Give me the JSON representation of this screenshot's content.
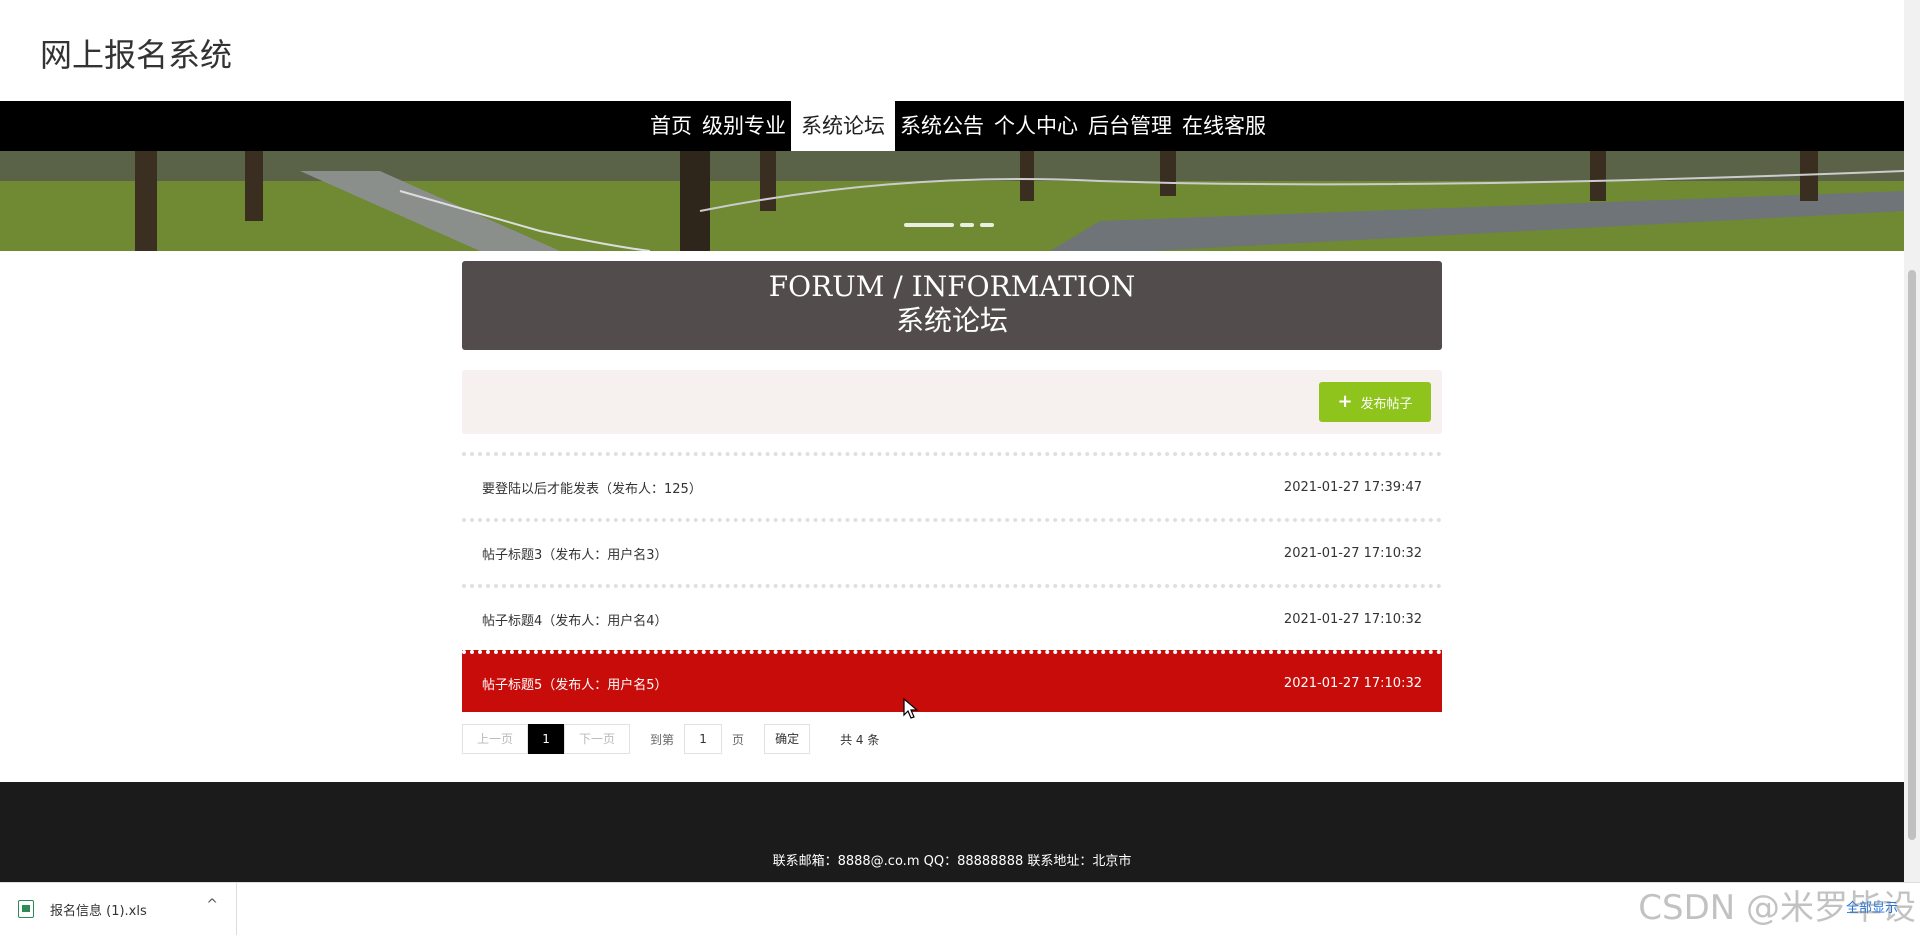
{
  "site": {
    "title": "网上报名系统"
  },
  "nav": {
    "items": [
      {
        "label": "首页",
        "active": false
      },
      {
        "label": "级别专业",
        "active": false
      },
      {
        "label": "系统论坛",
        "active": true
      },
      {
        "label": "系统公告",
        "active": false
      },
      {
        "label": "个人中心",
        "active": false
      },
      {
        "label": "后台管理",
        "active": false
      },
      {
        "label": "在线客服",
        "active": false
      }
    ]
  },
  "section": {
    "title_en": "FORUM / INFORMATION",
    "title_cn": "系统论坛"
  },
  "toolbar": {
    "publish_label": "发布帖子",
    "publish_icon": "plus-icon",
    "publish_color": "#8ec41c"
  },
  "posts": [
    {
      "title": "要登陆以后才能发表（发布人：125）",
      "time": "2021-01-27 17:39:47"
    },
    {
      "title": "帖子标题3（发布人：用户名3）",
      "time": "2021-01-27 17:10:32"
    },
    {
      "title": "帖子标题4（发布人：用户名4）",
      "time": "2021-01-27 17:10:32"
    },
    {
      "title": "帖子标题5（发布人：用户名5）",
      "time": "2021-01-27 17:10:32",
      "highlight_color": "#c80c0a"
    }
  ],
  "pager": {
    "prev": "上一页",
    "current": "1",
    "next": "下一页",
    "goto_label": "到第",
    "page_input": "1",
    "page_unit": "页",
    "confirm": "确定",
    "total": "共 4 条"
  },
  "footer": {
    "text": "联系邮箱：8888@.co.m QQ：88888888 联系地址：北京市"
  },
  "downloads": {
    "file_name": "报名信息 (1).xls",
    "show_all": "全部显示"
  },
  "watermark": "CSDN @米罗毕设"
}
